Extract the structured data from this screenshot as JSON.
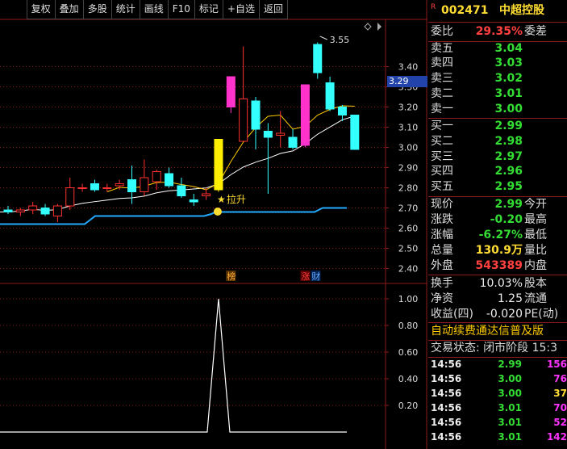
{
  "toolbar": {
    "buttons": [
      "复权",
      "叠加",
      "多股",
      "统计",
      "画线",
      "F10",
      "标记",
      "+自选",
      "返回"
    ]
  },
  "chart": {
    "current_price_tag": "3.29",
    "y_axis_ticks": [
      "3.40",
      "3.30",
      "3.20",
      "3.10",
      "3.00",
      "2.90",
      "2.80",
      "2.70",
      "2.60",
      "2.50",
      "2.40"
    ],
    "high_label": "3.55",
    "signal_label": "拉升",
    "marker_bang": "榜",
    "marker_zhang": "涨",
    "marker_cai": "财",
    "sub_ticks": [
      "1.00",
      "0.80",
      "0.60",
      "0.40",
      "0.20"
    ],
    "colors": {
      "up": "#ff3030",
      "down": "#33ffff",
      "ma5": "#ffcc00",
      "ma10": "#ffffff",
      "support": "#22aaff",
      "magenta": "#ff33cc",
      "yellow_bar": "#ffee00",
      "grid": "#8b1a1a"
    },
    "candles": [
      {
        "o": 2.69,
        "h": 2.71,
        "l": 2.67,
        "c": 2.68
      },
      {
        "o": 2.68,
        "h": 2.7,
        "l": 2.66,
        "c": 2.69
      },
      {
        "o": 2.69,
        "h": 2.73,
        "l": 2.67,
        "c": 2.71
      },
      {
        "o": 2.7,
        "h": 2.72,
        "l": 2.66,
        "c": 2.67
      },
      {
        "o": 2.66,
        "h": 2.72,
        "l": 2.63,
        "c": 2.71
      },
      {
        "o": 2.71,
        "h": 2.85,
        "l": 2.69,
        "c": 2.8
      },
      {
        "o": 2.8,
        "h": 2.82,
        "l": 2.78,
        "c": 2.8
      },
      {
        "o": 2.82,
        "h": 2.84,
        "l": 2.78,
        "c": 2.79
      },
      {
        "o": 2.8,
        "h": 2.82,
        "l": 2.78,
        "c": 2.8
      },
      {
        "o": 2.81,
        "h": 2.84,
        "l": 2.79,
        "c": 2.82
      },
      {
        "o": 2.84,
        "h": 2.91,
        "l": 2.72,
        "c": 2.78
      },
      {
        "o": 2.78,
        "h": 2.94,
        "l": 2.76,
        "c": 2.85
      },
      {
        "o": 2.83,
        "h": 2.89,
        "l": 2.79,
        "c": 2.88
      },
      {
        "o": 2.87,
        "h": 2.9,
        "l": 2.8,
        "c": 2.81
      },
      {
        "o": 2.81,
        "h": 2.85,
        "l": 2.75,
        "c": 2.76
      },
      {
        "o": 2.74,
        "h": 2.77,
        "l": 2.71,
        "c": 2.73
      },
      {
        "o": 2.76,
        "h": 2.8,
        "l": 2.74,
        "c": 2.77
      },
      {
        "o": 2.79,
        "h": 3.04,
        "l": 2.78,
        "c": 3.04
      },
      {
        "o": 3.2,
        "h": 3.35,
        "l": 3.17,
        "c": 3.35
      },
      {
        "o": 3.03,
        "h": 3.5,
        "l": 3.03,
        "c": 3.24
      },
      {
        "o": 3.23,
        "h": 3.25,
        "l": 2.99,
        "c": 3.09
      },
      {
        "o": 3.08,
        "h": 3.12,
        "l": 2.77,
        "c": 3.05
      },
      {
        "o": 3.06,
        "h": 3.18,
        "l": 3.0,
        "c": 3.07
      },
      {
        "o": 3.05,
        "h": 3.09,
        "l": 2.99,
        "c": 3.0
      },
      {
        "o": 3.01,
        "h": 3.31,
        "l": 3.0,
        "c": 3.31
      },
      {
        "o": 3.51,
        "h": 3.52,
        "l": 3.34,
        "c": 3.37
      },
      {
        "o": 3.32,
        "h": 3.35,
        "l": 3.18,
        "c": 3.19
      },
      {
        "o": 3.2,
        "h": 3.21,
        "l": 3.13,
        "c": 3.16
      },
      {
        "o": 3.16,
        "h": 3.16,
        "l": 2.99,
        "c": 2.99
      }
    ],
    "special": {
      "17": "yellow",
      "18": "magenta",
      "24": "magenta"
    }
  },
  "side": {
    "code_prefix": "R",
    "code": "002471",
    "name": "中超控股",
    "weibi_label": "委比",
    "weibi_value": "29.35%",
    "weicha_label": "委差",
    "sell": [
      {
        "label": "卖五",
        "price": "3.04"
      },
      {
        "label": "卖四",
        "price": "3.03"
      },
      {
        "label": "卖三",
        "price": "3.02"
      },
      {
        "label": "卖二",
        "price": "3.01"
      },
      {
        "label": "卖一",
        "price": "3.00"
      }
    ],
    "buy": [
      {
        "label": "买一",
        "price": "2.99"
      },
      {
        "label": "买二",
        "price": "2.98"
      },
      {
        "label": "买三",
        "price": "2.97"
      },
      {
        "label": "买四",
        "price": "2.96"
      },
      {
        "label": "买五",
        "price": "2.95"
      }
    ],
    "stats": [
      {
        "l1": "现价",
        "v": "2.99",
        "cls": "green",
        "l2": "今开"
      },
      {
        "l1": "涨跌",
        "v": "-0.20",
        "cls": "green",
        "l2": "最高"
      },
      {
        "l1": "涨幅",
        "v": "-6.27%",
        "cls": "green",
        "l2": "最低"
      },
      {
        "l1": "总量",
        "v": "130.9万",
        "cls": "yellow",
        "l2": "量比"
      },
      {
        "l1": "外盘",
        "v": "543389",
        "cls": "red",
        "l2": "内盘"
      }
    ],
    "stats2": [
      {
        "l1": "换手",
        "v": "10.03%",
        "cls": "white",
        "l2": "股本"
      },
      {
        "l1": "净资",
        "v": "1.25",
        "cls": "white",
        "l2": "流通"
      },
      {
        "l1": "收益(四)",
        "v": "-0.020",
        "cls": "white",
        "l2": "PE(动)"
      }
    ],
    "banner": "自动续费通达信普及版",
    "status": "交易状态: 闭市阶段 15:3",
    "ticks": [
      {
        "t": "14:56",
        "p": "2.99",
        "cls": "green",
        "v": "156"
      },
      {
        "t": "14:56",
        "p": "3.00",
        "cls": "green",
        "v": "76"
      },
      {
        "t": "14:56",
        "p": "3.00",
        "cls": "green",
        "v": "37"
      },
      {
        "t": "14:56",
        "p": "3.01",
        "cls": "green",
        "v": "70"
      },
      {
        "t": "14:56",
        "p": "3.01",
        "cls": "green",
        "v": "52"
      },
      {
        "t": "14:56",
        "p": "3.01",
        "cls": "green",
        "v": "142"
      }
    ]
  }
}
